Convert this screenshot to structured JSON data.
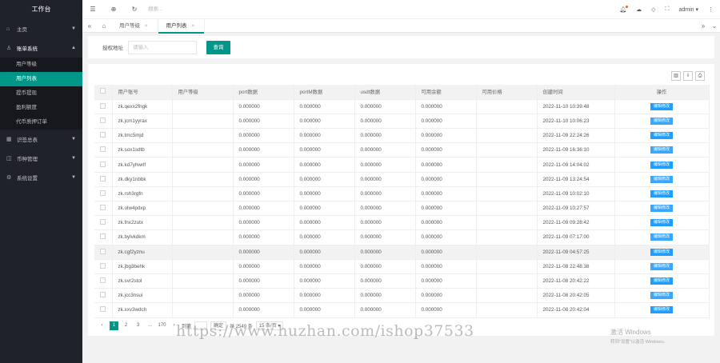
{
  "sidebar": {
    "brand": "工作台",
    "items": [
      {
        "label": "主页"
      },
      {
        "label": "账单系统",
        "children": [
          "用户等级",
          "用户列表",
          "提币提现",
          "盈利额度",
          "代币质押订单"
        ]
      },
      {
        "label": "识签总表"
      },
      {
        "label": "币种管理"
      },
      {
        "label": "系统设置"
      }
    ],
    "active_child": "用户列表"
  },
  "header": {
    "search_placeholder": "搜索...",
    "user": "admin"
  },
  "tabs": [
    {
      "label": "用户等级"
    },
    {
      "label": "用户列表"
    }
  ],
  "filter": {
    "label": "授权地址",
    "placeholder": "请输入",
    "button": "查询"
  },
  "table": {
    "columns": [
      "用户账号",
      "用户等级",
      "port数据",
      "portM数据",
      "usdt数据",
      "可用余额",
      "可用价格",
      "创建时间",
      "操作"
    ],
    "rows": [
      {
        "account": "zk.qexx2fngk",
        "level": "",
        "port": "0.000000",
        "portm": "0.000000",
        "usdt": "0.000000",
        "balance": "0.000000",
        "price": "",
        "time": "2022-11-10 10:39:48",
        "op": "编辑修改"
      },
      {
        "account": "zk.jcm1yyrax",
        "level": "",
        "port": "0.000000",
        "portm": "0.000000",
        "usdt": "0.000000",
        "balance": "0.000000",
        "price": "",
        "time": "2022-11-10 10:06:23",
        "op": "编辑修改"
      },
      {
        "account": "zk.tmc5mjd",
        "level": "",
        "port": "0.000000",
        "portm": "0.000000",
        "usdt": "0.000000",
        "balance": "0.000000",
        "price": "",
        "time": "2022-11-09 22:24:26",
        "op": "编辑修改"
      },
      {
        "account": "zk.sox1sdtb",
        "level": "",
        "port": "0.000000",
        "portm": "0.000000",
        "usdt": "0.000000",
        "balance": "0.000000",
        "price": "",
        "time": "2022-11-09 16:36:10",
        "op": "编辑修改"
      },
      {
        "account": "zk.kd7yhwrlf",
        "level": "",
        "port": "0.000000",
        "portm": "0.000000",
        "usdt": "0.000000",
        "balance": "0.000000",
        "price": "",
        "time": "2022-11-09 14:04:02",
        "op": "编辑修改"
      },
      {
        "account": "zk.dky1nbbk",
        "level": "",
        "port": "0.000000",
        "portm": "0.000000",
        "usdt": "0.000000",
        "balance": "0.000000",
        "price": "",
        "time": "2022-11-09 13:24:54",
        "op": "编辑修改"
      },
      {
        "account": "zk.rsh3rgfn",
        "level": "",
        "port": "0.000000",
        "portm": "0.000000",
        "usdt": "0.000000",
        "balance": "0.000000",
        "price": "",
        "time": "2022-11-09 10:02:10",
        "op": "编辑修改"
      },
      {
        "account": "zk.olw4pdxp",
        "level": "",
        "port": "0.000000",
        "portm": "0.000000",
        "usdt": "0.000000",
        "balance": "0.000000",
        "price": "",
        "time": "2022-11-09 10:27:57",
        "op": "编辑修改"
      },
      {
        "account": "zk.fnx2zutx",
        "level": "",
        "port": "0.000000",
        "portm": "0.000000",
        "usdt": "0.000000",
        "balance": "0.000000",
        "price": "",
        "time": "2022-11-09 09:28:42",
        "op": "编辑修改"
      },
      {
        "account": "zk.bylvkdkm",
        "level": "",
        "port": "0.000000",
        "portm": "0.000000",
        "usdt": "0.000000",
        "balance": "0.000000",
        "price": "",
        "time": "2022-11-09 07:17:00",
        "op": "编辑修改"
      },
      {
        "account": "zk.cgf2yznu",
        "level": "",
        "port": "0.000000",
        "portm": "0.000000",
        "usdt": "0.000000",
        "balance": "0.000000",
        "price": "",
        "time": "2022-11-09 04:57:25",
        "op": "编辑修改"
      },
      {
        "account": "zk.jbg3behk",
        "level": "",
        "port": "0.000000",
        "portm": "0.000000",
        "usdt": "0.000000",
        "balance": "0.000000",
        "price": "",
        "time": "2022-11-08 22:48:38",
        "op": "编辑修改"
      },
      {
        "account": "zk.svr2stol",
        "level": "",
        "port": "0.000000",
        "portm": "0.000000",
        "usdt": "0.000000",
        "balance": "0.000000",
        "price": "",
        "time": "2022-11-08 20:42:22",
        "op": "编辑修改"
      },
      {
        "account": "zk.jcc3nsui",
        "level": "",
        "port": "0.000000",
        "portm": "0.000000",
        "usdt": "0.000000",
        "balance": "0.000000",
        "price": "",
        "time": "2022-11-08 20:42:05",
        "op": "编辑修改"
      },
      {
        "account": "zk.xxv3wdch",
        "level": "",
        "port": "0.000000",
        "portm": "0.000000",
        "usdt": "0.000000",
        "balance": "0.000000",
        "price": "",
        "time": "2022-11-08 20:42:04",
        "op": "编辑修改"
      }
    ],
    "highlight_row": 10
  },
  "pagination": {
    "pages": [
      "1",
      "2",
      "3",
      "...",
      "170"
    ],
    "goto_label": "到第",
    "confirm": "确定",
    "total": "共 2549 条",
    "page_size": "15 条/页"
  },
  "watermark": "https://www.huzhan.com/ishop37533",
  "activate": {
    "line1": "激活 Windows",
    "line2": "转到“设置”以激活 Windows。"
  }
}
